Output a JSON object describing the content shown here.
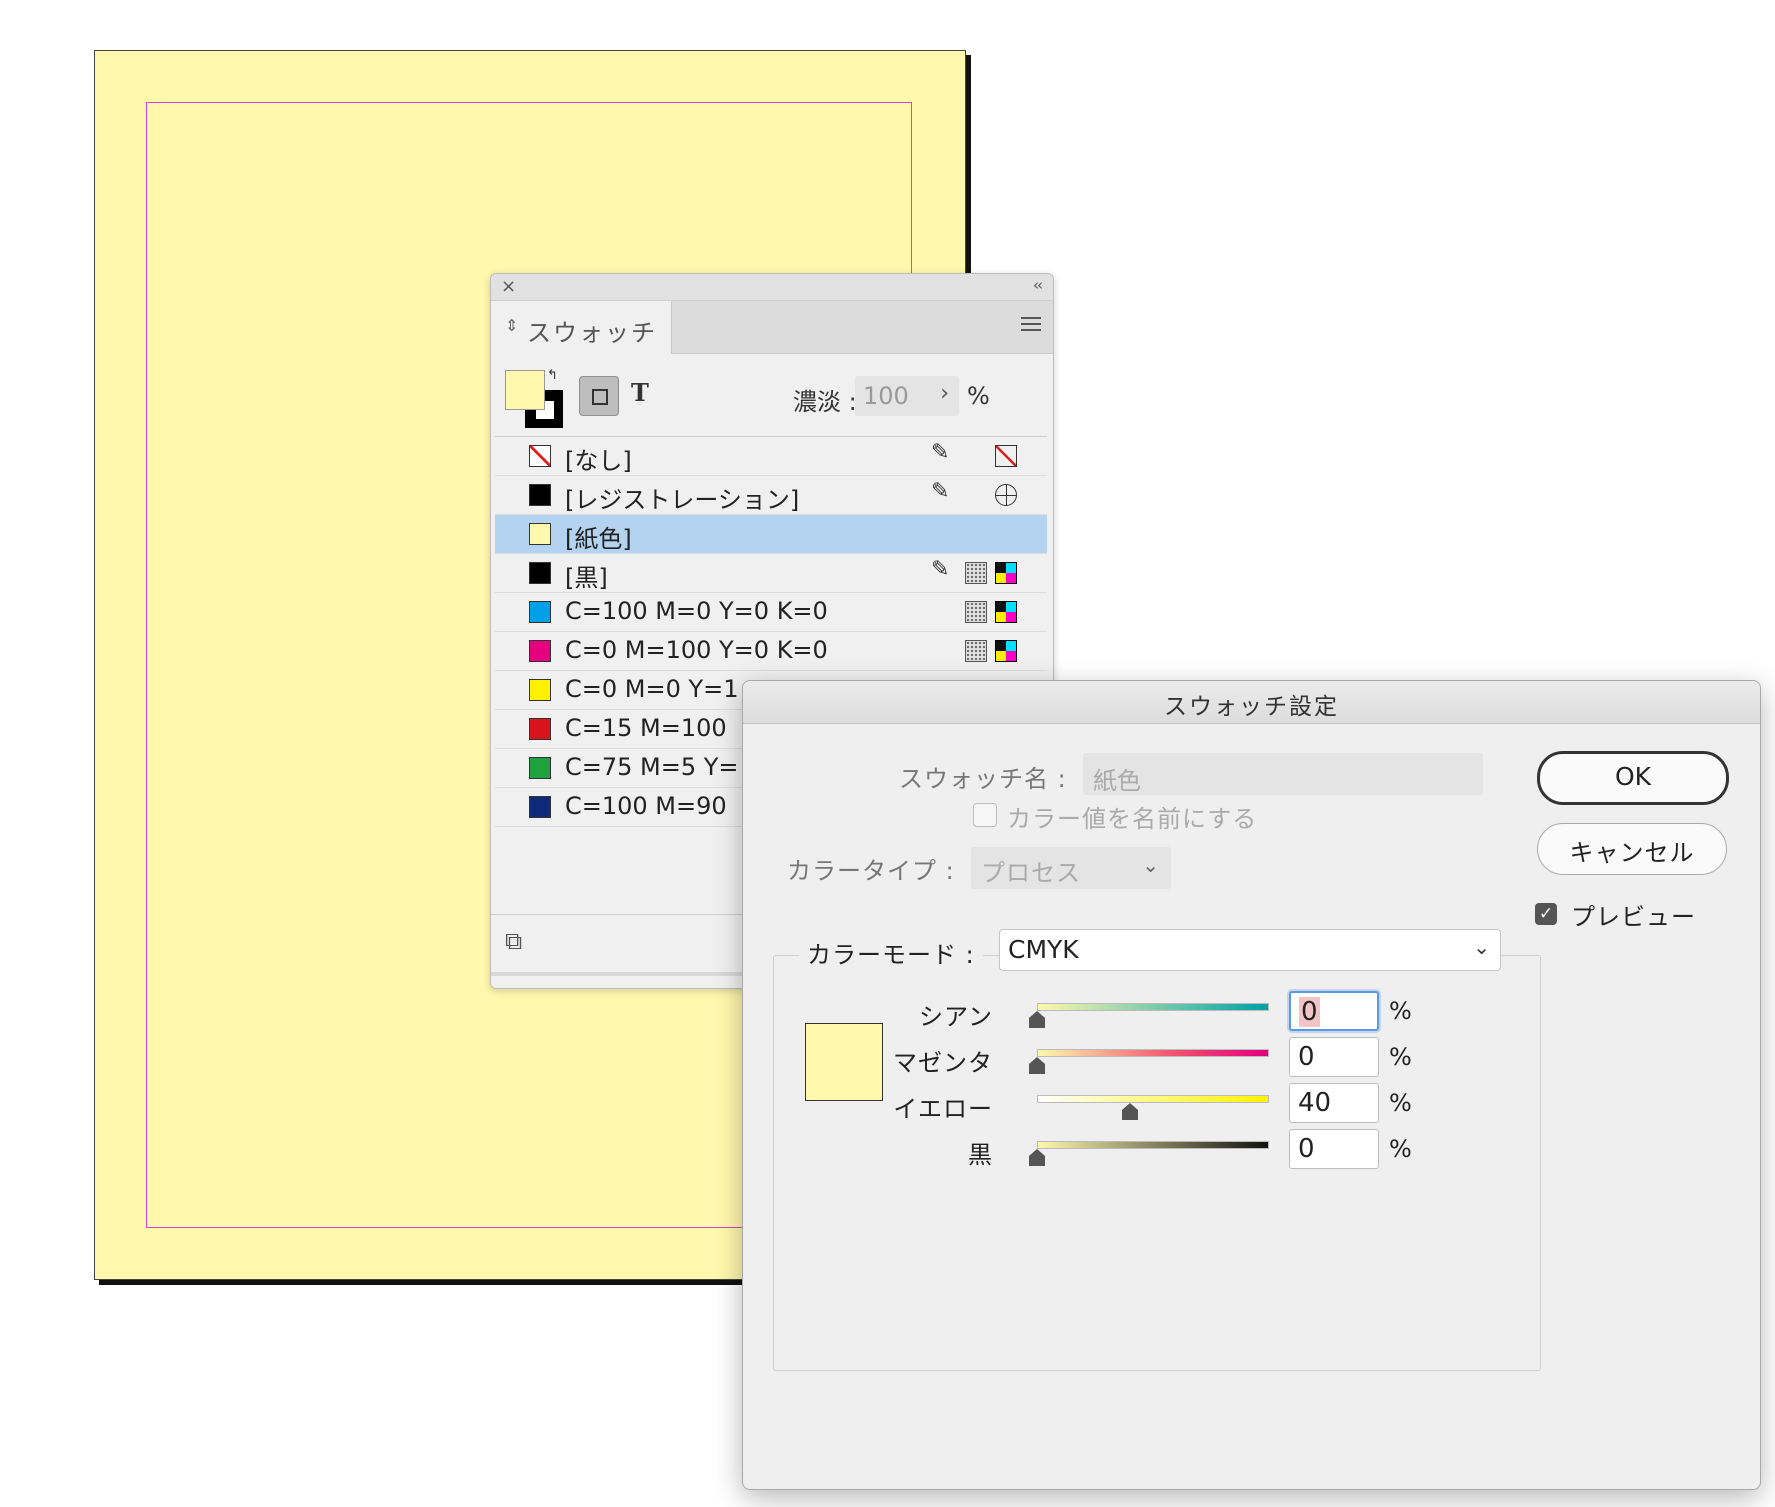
{
  "swatches_panel": {
    "close_icon": "×",
    "collapse_icon": "‹‹",
    "tab_label": "スウォッチ",
    "tint_label": "濃淡 :",
    "tint_value": "100",
    "tint_unit": "%",
    "swatches": [
      {
        "name": "[なし]",
        "color": "#ffffff",
        "kind": "none",
        "icons": [
          "pencil-off",
          "none"
        ]
      },
      {
        "name": "[レジストレーション]",
        "color": "#000000",
        "kind": "solid",
        "icons": [
          "pencil-off",
          "registration"
        ]
      },
      {
        "name": "[紙色]",
        "color": "#fff8ad",
        "kind": "solid",
        "icons": [],
        "selected": true
      },
      {
        "name": "[黒]",
        "color": "#000000",
        "kind": "solid",
        "icons": [
          "pencil-off",
          "process",
          "cmyk"
        ]
      },
      {
        "name": "C=100 M=0 Y=0 K=0",
        "color": "#00a0e9",
        "kind": "solid",
        "icons": [
          "process",
          "cmyk"
        ]
      },
      {
        "name": "C=0 M=100 Y=0 K=0",
        "color": "#e4007f",
        "kind": "solid",
        "icons": [
          "process",
          "cmyk"
        ]
      },
      {
        "name": "C=0 M=0 Y=1",
        "color": "#fff100",
        "kind": "solid",
        "icons": []
      },
      {
        "name": "C=15 M=100",
        "color": "#d7141c",
        "kind": "solid",
        "icons": []
      },
      {
        "name": "C=75 M=5 Y=",
        "color": "#1ea23c",
        "kind": "solid",
        "icons": []
      },
      {
        "name": "C=100 M=90",
        "color": "#0f2a7a",
        "kind": "solid",
        "icons": []
      }
    ]
  },
  "dialog": {
    "title": "スウォッチ設定",
    "swatch_name_label": "スウォッチ名 :",
    "swatch_name_value": "紙色",
    "name_with_value_label": "カラー値を名前にする",
    "name_with_value_checked": false,
    "color_type_label": "カラータイプ :",
    "color_type_value": "プロセス",
    "color_mode_label": "カラーモード :",
    "color_mode_value": "CMYK",
    "preview_color": "#fff8ad",
    "sliders": [
      {
        "label": "シアン",
        "value": "0",
        "unit": "%",
        "fraction": 0
      },
      {
        "label": "マゼンタ",
        "value": "0",
        "unit": "%",
        "fraction": 0
      },
      {
        "label": "イエロー",
        "value": "40",
        "unit": "%",
        "fraction": 0.4
      },
      {
        "label": "黒",
        "value": "0",
        "unit": "%",
        "fraction": 0
      }
    ],
    "ok_label": "OK",
    "cancel_label": "キャンセル",
    "preview_label": "プレビュー",
    "preview_checked": true
  }
}
